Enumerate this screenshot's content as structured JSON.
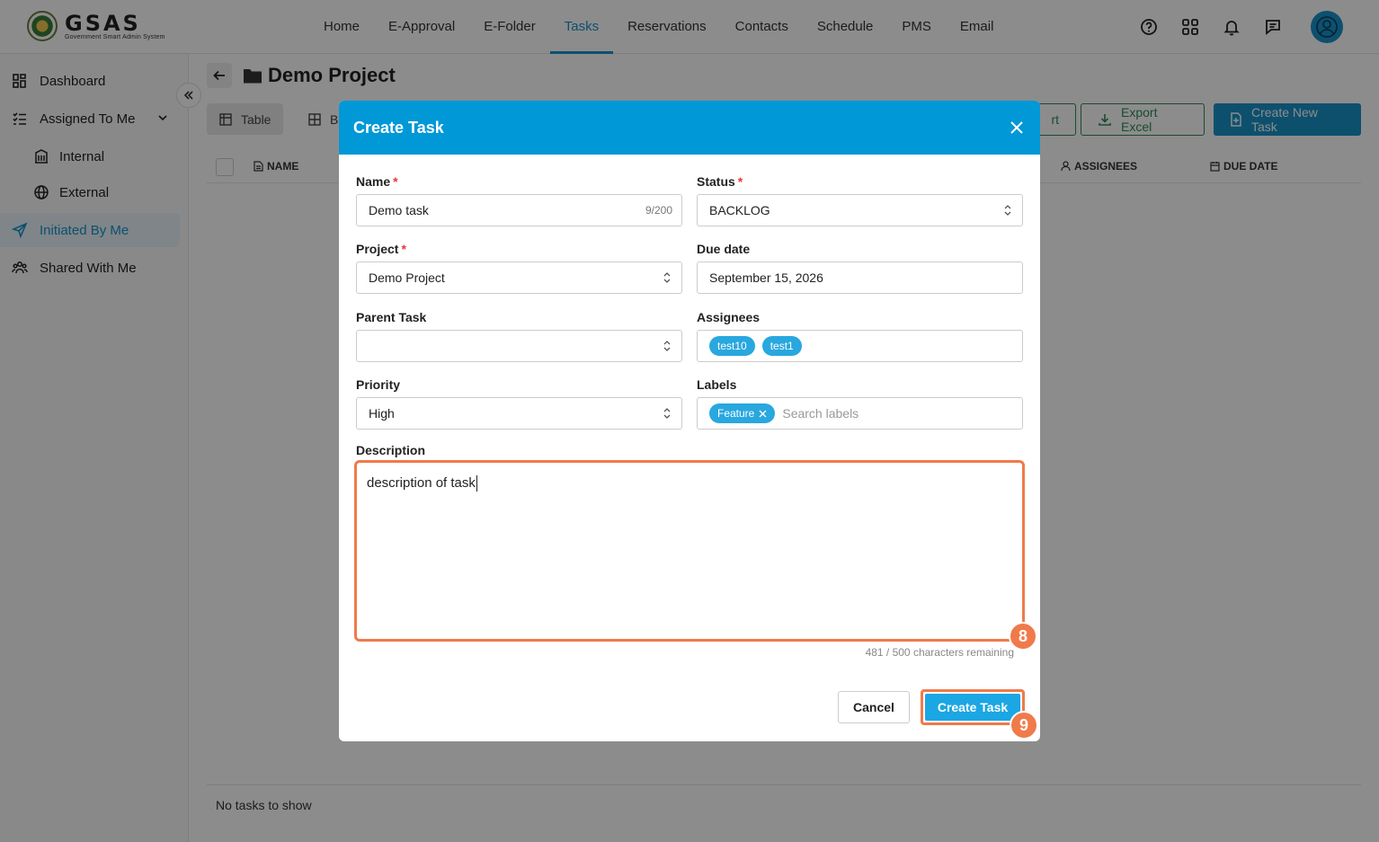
{
  "app": {
    "logo_text": "GSAS",
    "logo_subtitle": "Government Smart Admin System"
  },
  "nav": {
    "items": [
      {
        "label": "Home"
      },
      {
        "label": "E-Approval"
      },
      {
        "label": "E-Folder"
      },
      {
        "label": "Tasks",
        "active": true
      },
      {
        "label": "Reservations"
      },
      {
        "label": "Contacts"
      },
      {
        "label": "Schedule"
      },
      {
        "label": "PMS"
      },
      {
        "label": "Email"
      }
    ],
    "accent_color": "#1993c9"
  },
  "header_icons": [
    "help-icon",
    "apps-grid-icon",
    "bell-icon",
    "chat-icon",
    "user-avatar-icon"
  ],
  "sidebar": {
    "items": [
      {
        "label": "Dashboard",
        "icon": "dashboard-icon"
      },
      {
        "label": "Assigned To Me",
        "icon": "list-check-icon"
      },
      {
        "label": "Internal",
        "icon": "building-icon"
      },
      {
        "label": "External",
        "icon": "globe-icon"
      },
      {
        "label": "Initiated By Me",
        "icon": "send-icon"
      },
      {
        "label": "Shared With Me",
        "icon": "users-icon"
      }
    ]
  },
  "page": {
    "title": "Demo Project",
    "view_tabs": [
      {
        "label": "Table"
      },
      {
        "label": "B"
      }
    ],
    "toolbar": {
      "import_partial": "rt",
      "export_label": "Export Excel",
      "create_label": "Create New Task"
    },
    "table": {
      "columns": [
        "NAME",
        "ASSIGNEES",
        "DUE DATE"
      ],
      "empty_text": "No tasks to show"
    }
  },
  "modal": {
    "title": "Create Task",
    "fields": {
      "name": {
        "label": "Name",
        "value": "Demo task",
        "counter": "9/200"
      },
      "status": {
        "label": "Status",
        "value": "BACKLOG"
      },
      "project": {
        "label": "Project",
        "value": "Demo Project"
      },
      "due_date": {
        "label": "Due date",
        "value": "September 15, 2026"
      },
      "parent_task": {
        "label": "Parent Task",
        "value": ""
      },
      "assignees": {
        "label": "Assignees",
        "chips": [
          "test10",
          "test1"
        ]
      },
      "priority": {
        "label": "Priority",
        "value": "High"
      },
      "labels": {
        "label": "Labels",
        "chips": [
          "Feature"
        ],
        "placeholder": "Search labels"
      },
      "description": {
        "label": "Description",
        "value": "description of task",
        "remaining": "481 / 500 characters remaining"
      }
    },
    "cancel_label": "Cancel",
    "create_label": "Create Task",
    "header_color": "#0098d6"
  },
  "annotations": {
    "step_description": "8",
    "step_create": "9",
    "highlight_color": "#f07a4a"
  }
}
